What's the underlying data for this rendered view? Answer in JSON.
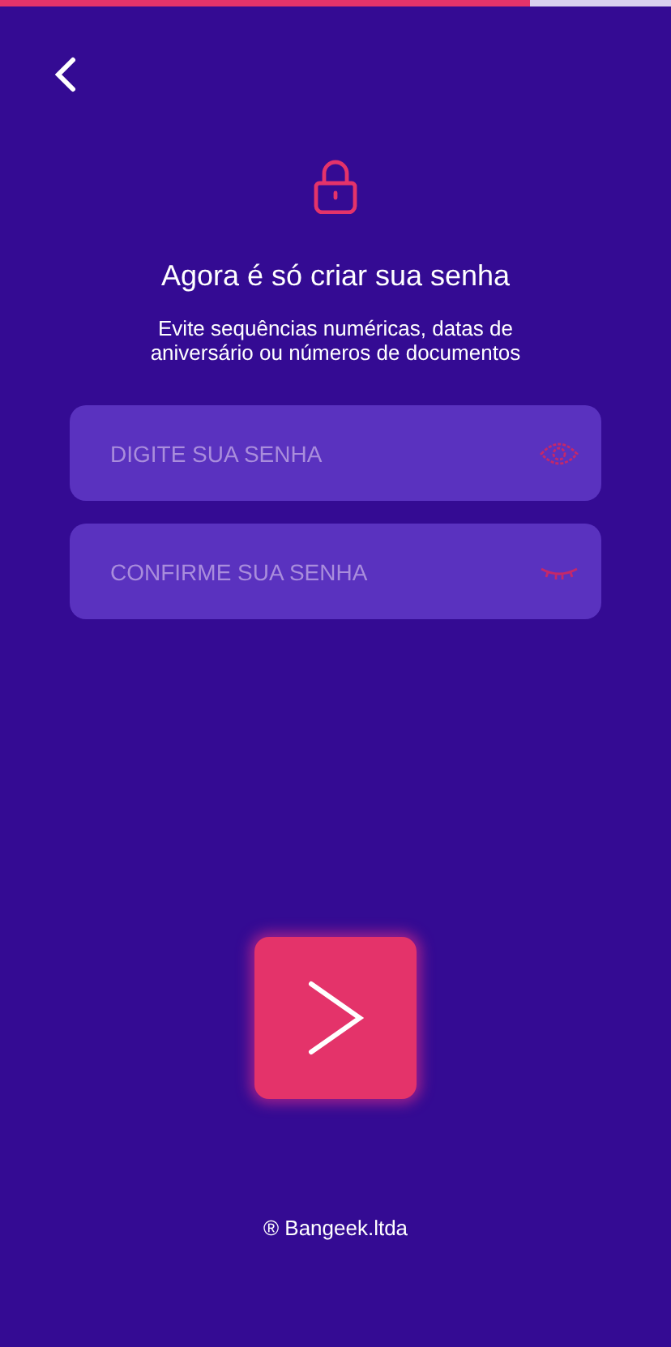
{
  "progress": {
    "level": 0.79
  },
  "title": "Agora é só criar sua senha",
  "subtitle": "Evite sequências numéricas, datas de aniversário ou números de documentos",
  "fields": [
    {
      "placeholder": "DIGITE SUA SENHA",
      "password_visible": true
    },
    {
      "placeholder": "CONFIRME SUA SENHA",
      "password_visible": false
    }
  ],
  "footer": "® Bangeek.ltda"
}
